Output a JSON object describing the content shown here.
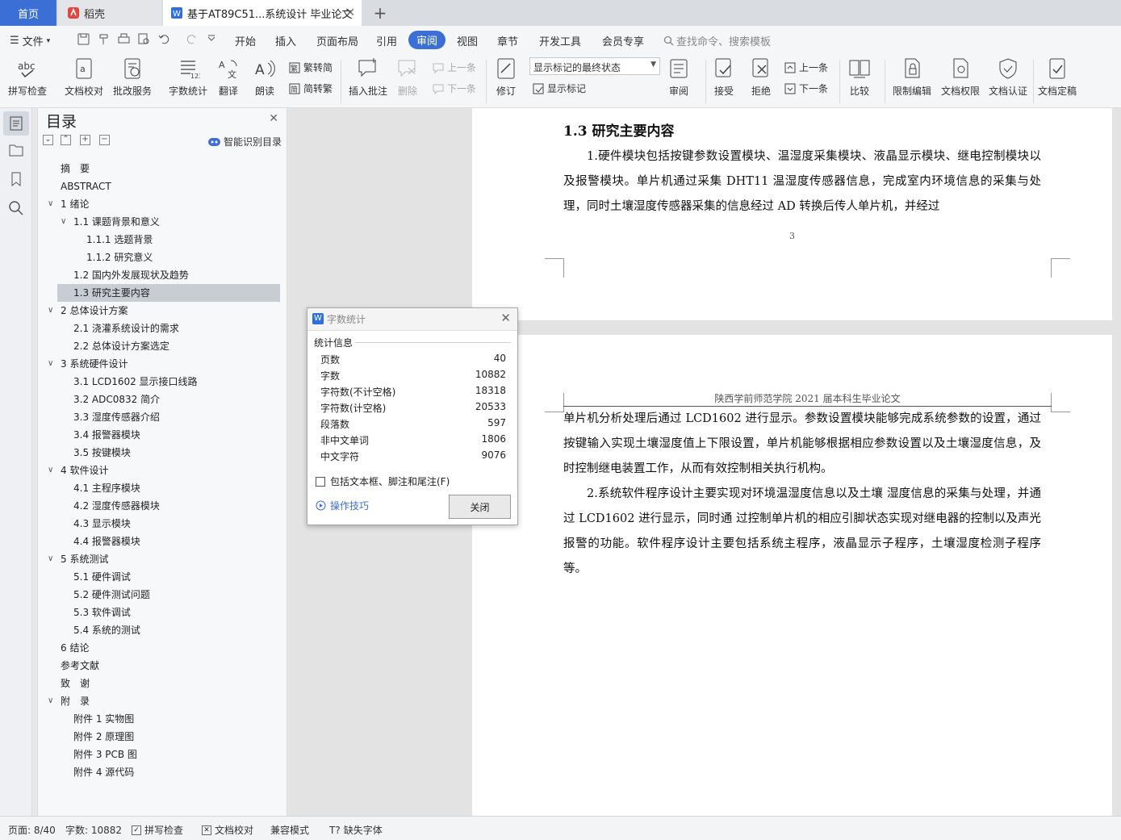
{
  "tabs": {
    "home": "首页",
    "daoke": "稻壳",
    "document": "基于AT89C51...系统设计 毕业论文"
  },
  "menu": {
    "file": "文件",
    "items": [
      "开始",
      "插入",
      "页面布局",
      "引用",
      "审阅",
      "视图",
      "章节",
      "开发工具",
      "会员专享"
    ],
    "active": "审阅",
    "search": "查找命令、搜索模板"
  },
  "ribbon": {
    "spell_check": "拼写检查",
    "doc_proof": "文档校对",
    "batch_service": "批改服务",
    "word_count": "字数统计",
    "translate": "翻译",
    "read_aloud": "朗读",
    "trad_to_simp": "繁转简",
    "simp_to_trad": "简转繁",
    "insert_comment": "插入批注",
    "delete": "删除",
    "prev": "上一条",
    "next": "下一条",
    "revise": "修订",
    "markup_state": "显示标记的最终状态",
    "show_markup": "显示标记",
    "review": "审阅",
    "accept": "接受",
    "reject": "拒绝",
    "prev2": "上一条",
    "next2": "下一条",
    "compare": "比较",
    "restrict_edit": "限制编辑",
    "doc_permission": "文档权限",
    "doc_cert": "文档认证",
    "doc_final": "文档定稿"
  },
  "toc": {
    "title": "目录",
    "smart": "智能识别目录",
    "items": [
      {
        "text": "摘　要",
        "level": 0
      },
      {
        "text": "ABSTRACT",
        "level": 0
      },
      {
        "text": "1  绪论",
        "level": 0,
        "toggle": true
      },
      {
        "text": "1.1  课题背景和意义",
        "level": 1,
        "toggle": true
      },
      {
        "text": "1.1.1 选题背景",
        "level": 2
      },
      {
        "text": "1.1.2 研究意义",
        "level": 2
      },
      {
        "text": "1.2  国内外发展现状及趋势",
        "level": 1
      },
      {
        "text": "1.3 研究主要内容",
        "level": 1,
        "selected": true
      },
      {
        "text": "2  总体设计方案",
        "level": 0,
        "toggle": true
      },
      {
        "text": "2.1  浇灌系统设计的需求",
        "level": 1
      },
      {
        "text": "2.2  总体设计方案选定",
        "level": 1
      },
      {
        "text": "3  系统硬件设计",
        "level": 0,
        "toggle": true
      },
      {
        "text": "3.1 LCD1602 显示接口线路",
        "level": 1
      },
      {
        "text": "3.2 ADC0832 简介",
        "level": 1
      },
      {
        "text": "3.3  湿度传感器介绍",
        "level": 1
      },
      {
        "text": "3.4  报警器模块",
        "level": 1
      },
      {
        "text": "3.5  按键模块",
        "level": 1
      },
      {
        "text": "4  软件设计",
        "level": 0,
        "toggle": true
      },
      {
        "text": "4.1  主程序模块",
        "level": 1
      },
      {
        "text": "4.2  湿度传感器模块",
        "level": 1
      },
      {
        "text": "4.3  显示模块",
        "level": 1
      },
      {
        "text": "4.4  报警器模块",
        "level": 1
      },
      {
        "text": "5  系统测试",
        "level": 0,
        "toggle": true
      },
      {
        "text": "5.1  硬件调试",
        "level": 1
      },
      {
        "text": "5.2  硬件测试问题",
        "level": 1
      },
      {
        "text": "5.3  软件调试",
        "level": 1
      },
      {
        "text": "5.4  系统的测试",
        "level": 1
      },
      {
        "text": "6  结论",
        "level": 0
      },
      {
        "text": "参考文献",
        "level": 0
      },
      {
        "text": "致　谢",
        "level": 0
      },
      {
        "text": "附　录",
        "level": 0,
        "toggle": true
      },
      {
        "text": "附件 1  实物图",
        "level": 1
      },
      {
        "text": "附件 2  原理图",
        "level": 1
      },
      {
        "text": "附件 3 PCB 图",
        "level": 1
      },
      {
        "text": "附件 4  源代码",
        "level": 1
      }
    ]
  },
  "doc": {
    "heading": "1.3 研究主要内容",
    "para1": "1.硬件模块包括按键参数设置模块、温湿度采集模块、液晶显示模块、继电控制模块以及报警模块。单片机通过采集 DHT11 温湿度传感器信息，完成室内环境信息的采集与处理，同时土壤湿度传感器采集的信息经过 AD 转换后传人单片机，并经过",
    "page_number": "3",
    "running_header": "陕西学前师范学院 2021 届本科生毕业论文",
    "para2": "单片机分析处理后通过 LCD1602 进行显示。参数设置模块能够完成系统参数的设置，通过按键输入实现土壤湿度值上下限设置，单片机能够根据相应参数设置以及土壤湿度信息，及时控制继电装置工作，从而有效控制相关执行机构。",
    "para3": "2.系统软件程序设计主要实现对环境温湿度信息以及土壤  湿度信息的采集与处理，并通过 LCD1602 进行显示，同时通  过控制单片机的相应引脚状态实现对继电器的控制以及声光报警的功能。软件程序设计主要包括系统主程序，液晶显示子程序，土壤湿度检测子程序等。"
  },
  "dialog": {
    "title": "字数统计",
    "section": "统计信息",
    "stats": [
      {
        "label": "页数",
        "value": "40"
      },
      {
        "label": "字数",
        "value": "10882"
      },
      {
        "label": "字符数(不计空格)",
        "value": "18318"
      },
      {
        "label": "字符数(计空格)",
        "value": "20533"
      },
      {
        "label": "段落数",
        "value": "597"
      },
      {
        "label": "非中文单词",
        "value": "1806"
      },
      {
        "label": "中文字符",
        "value": "9076"
      }
    ],
    "include_label": "包括文本框、脚注和尾注(F)",
    "tips": "操作技巧",
    "close": "关闭"
  },
  "status": {
    "page": "页面: 8/40",
    "words": "字数: 10882",
    "spell": "拼写检查",
    "proof": "文档校对",
    "compat": "兼容模式",
    "missing_font": "缺失字体"
  },
  "colors": {
    "accent": "#3c6fd6",
    "selected_row": "#c8ccd3"
  }
}
